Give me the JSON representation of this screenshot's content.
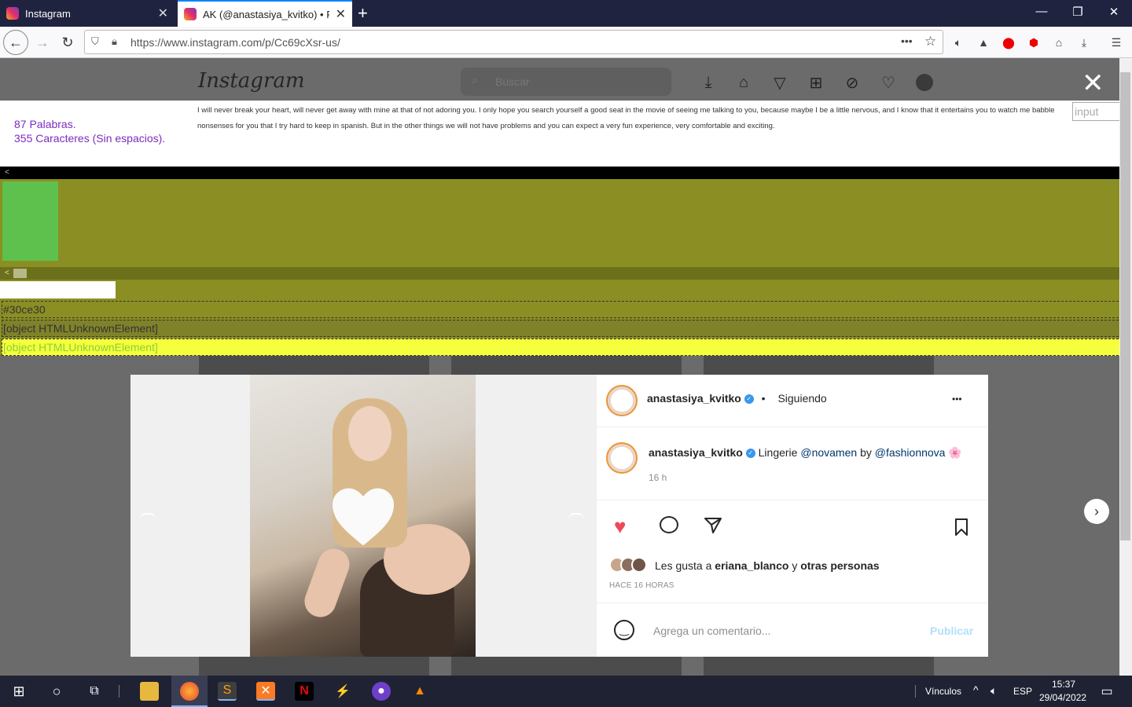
{
  "browser": {
    "tabs": [
      {
        "title": "Instagram"
      },
      {
        "title": "AK (@anastasiya_kvitko) • Foto"
      }
    ],
    "url": "https://www.instagram.com/p/Cc69cXsr-us/"
  },
  "instagram": {
    "logo": "Instagram",
    "search_placeholder": "Buscar"
  },
  "counter_panel": {
    "words": "87 Palabras.",
    "chars": "355 Caracteres (Sin espacios).",
    "text": "I will never break your heart, will never get away with mine at that of not adoring you. I only hope you search yourself a good seat in the movie of seeing me talking to you, because maybe I be a little nervous, and I know that it entertains you to watch me babble nonsenses for you that I try hard to keep in spanish. But in the other things we will not have problems and you can expect a very fun experience, very comfortable and exciting.",
    "input_placeholder": "input",
    "pause_glyph": "ll"
  },
  "debug_rows": {
    "color": "#30ce30",
    "element1": "[object HTMLUnknownElement]",
    "element2": "[object HTMLUnknownElement]"
  },
  "post": {
    "username": "anastasiya_kvitko",
    "separator": "•",
    "following": "Siguiendo",
    "more": "•••",
    "caption_prefix": "Lingerie",
    "mention1": "@novamen",
    "by": "by",
    "mention2": "@fashionnova",
    "emoji": "🌸",
    "time": "16 h",
    "likes_prefix": "Les gusta a",
    "likes_user": "eriana_blanco",
    "likes_and": "y",
    "likes_others": "otras personas",
    "timestamp": "HACE 16 HORAS",
    "comment_placeholder": "Agrega un comentario...",
    "publish": "Publicar"
  },
  "taskbar": {
    "links": "Vínculos",
    "lang": "ESP",
    "time": "15:37",
    "date": "29/04/2022"
  },
  "colors": {
    "heart_red": "#ed4956",
    "olive": "#8b8f23",
    "green_box": "#5ec14d",
    "yellow_row": "#f5ff3b",
    "purple_text": "#7b2cbf"
  }
}
